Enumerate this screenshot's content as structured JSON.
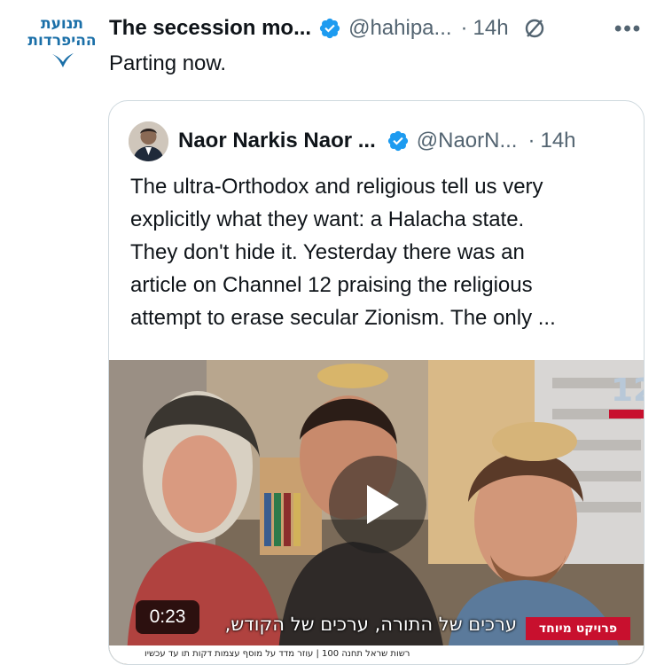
{
  "tweet": {
    "avatar_logo_text": "תנועת ההיפרדות",
    "display_name": "The secession mo...",
    "handle": "@hahipa...",
    "separator": "·",
    "time": "14h",
    "more_label": "•••",
    "text": "Parting now."
  },
  "quoted_tweet": {
    "display_name": "Naor Narkis Naor ...",
    "handle": "@NaorN...",
    "separator": "·",
    "time": "14h",
    "text_lines": [
      "The ultra-Orthodox and religious tell us very",
      "explicitly what they want: a Halacha state.",
      "They don't hide it. Yesterday there was an",
      "article on Channel 12 praising the religious",
      "attempt to erase secular Zionism. The only ..."
    ],
    "video": {
      "duration": "0:23",
      "caption": "ערכים של התורה, ערכים של הקודש,",
      "tag": "פרויקט מיוחד",
      "ticker": "רשות שראל תחנה 100 | עוזר מדד על מוסף עצמות דקות תו עד עכשיו",
      "channel_logo": "12"
    }
  },
  "colors": {
    "verified_blue": "#1d9bf0",
    "text_primary": "#0f1419",
    "text_secondary": "#536471",
    "border": "#cfd9de",
    "logo_blue": "#1a6fa8"
  }
}
